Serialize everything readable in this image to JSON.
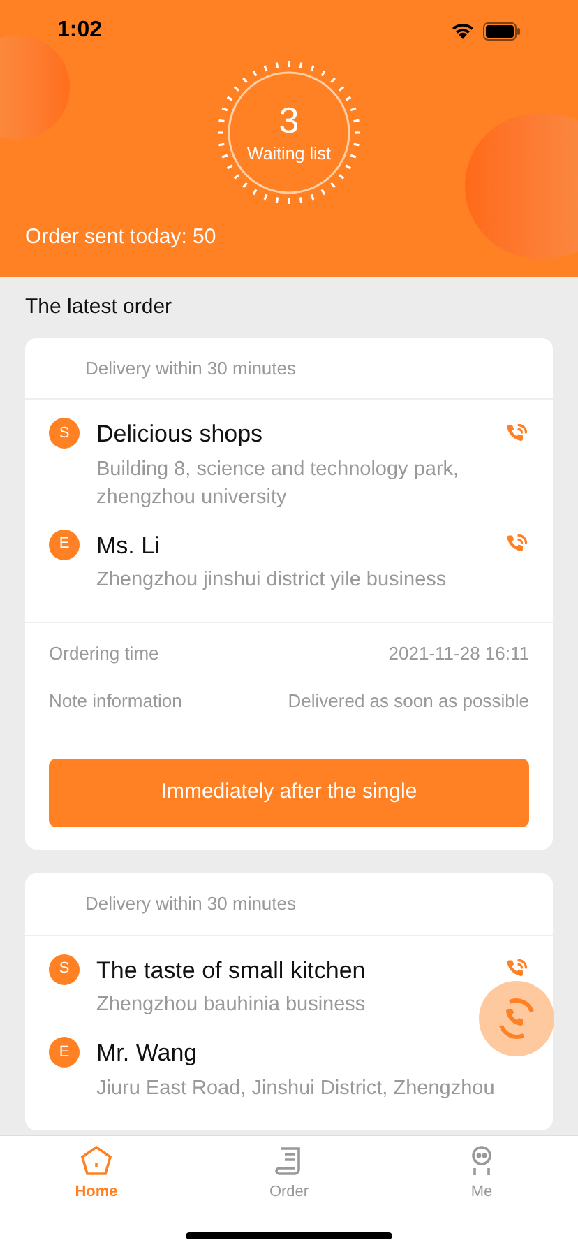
{
  "status_bar": {
    "time": "1:02"
  },
  "header": {
    "waiting_count": "3",
    "waiting_label": "Waiting list",
    "sent_today": "Order sent today: 50"
  },
  "section_title": "The latest order",
  "orders": [
    {
      "delivery": "Delivery within 30 minutes",
      "stops": [
        {
          "badge": "S",
          "name": "Delicious shops",
          "address": "Building 8, science and technology park, zhengzhou university",
          "call": true
        },
        {
          "badge": "E",
          "name": "Ms. Li",
          "address": "Zhengzhou jinshui district yile business",
          "call": true
        }
      ],
      "details": [
        {
          "label": "Ordering time",
          "value": "2021-11-28 16:11"
        },
        {
          "label": "Note information",
          "value": "Delivered as soon as possible"
        }
      ],
      "action": "Immediately after the single"
    },
    {
      "delivery": "Delivery within 30 minutes",
      "stops": [
        {
          "badge": "S",
          "name": "The taste of small kitchen",
          "address": "Zhengzhou bauhinia business",
          "call": true
        },
        {
          "badge": "E",
          "name": "Mr. Wang",
          "address": "Jiuru East Road, Jinshui District, Zhengzhou",
          "call": false
        }
      ]
    }
  ],
  "tabs": [
    {
      "label": "Home",
      "selected": true
    },
    {
      "label": "Order",
      "selected": false
    },
    {
      "label": "Me",
      "selected": false
    }
  ]
}
